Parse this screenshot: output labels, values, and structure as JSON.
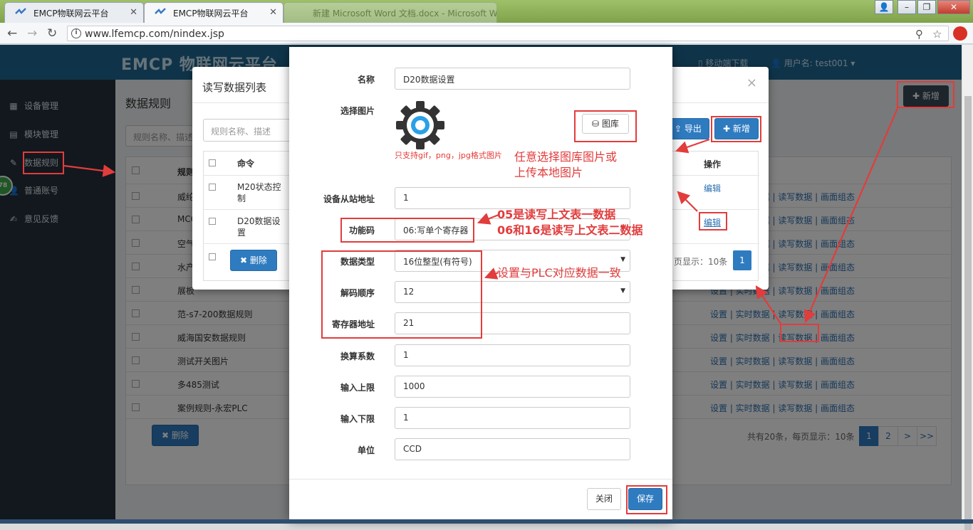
{
  "browser": {
    "tabs": [
      {
        "label": "EMCP物联网云平台"
      },
      {
        "label": "EMCP物联网云平台"
      },
      {
        "label": "新建 Microsoft Word 文档.docx - Microsoft Word"
      }
    ],
    "url": "www.lfemcp.com/nindex.jsp"
  },
  "app": {
    "brand": "EMCP 物联网云平台",
    "header_mobile": "移动端下载",
    "header_user": "用户名: test001"
  },
  "sidebar": {
    "items": [
      {
        "label": "设备管理"
      },
      {
        "label": "模块管理"
      },
      {
        "label": "数据规则"
      },
      {
        "label": "普通账号"
      },
      {
        "label": "意见反馈"
      }
    ],
    "badge": "78"
  },
  "bg": {
    "title": "数据规则",
    "search_placeholder": "规则名称、描述",
    "col_name": "规则",
    "new_label": "新增",
    "delete_label": "删除",
    "rows": [
      {
        "name": "威纶",
        "ops": "设置 | 实时数据 | 读写数据 | 画面组态"
      },
      {
        "name": "MCG",
        "ops": "设置 | 实时数据 | 读写数据 | 画面组态"
      },
      {
        "name": "空气",
        "ops": "设置 | 实时数据 | 读写数据 | 画面组态"
      },
      {
        "name": "水产",
        "ops": "设置 | 实时数据 | 读写数据 | 画面组态"
      },
      {
        "name": "展板",
        "ops": "设置 | 实时数据 | 读写数据 | 画面组态"
      },
      {
        "name": "范-s7-200数据规则",
        "ops": "设置 | 实时数据 | 读写数据 | 画面组态"
      },
      {
        "name": "威海国安数据规则",
        "ops": "设置 | 实时数据 | 读写数据 | 画面组态"
      },
      {
        "name": "测试开关图片",
        "ops": "设置 | 实时数据 | 读写数据 | 画面组态"
      },
      {
        "name": "多485测试",
        "ops": "设置 | 实时数据 | 读写数据 | 画面组态"
      },
      {
        "name": "案例规则-永宏PLC",
        "ops": "设置 | 实时数据 | 读写数据 | 画面组态"
      }
    ],
    "pager_info": "共有20条，每页显示：10条",
    "pages": [
      "1",
      "2",
      ">",
      ">>"
    ]
  },
  "modal_list": {
    "title": "读写数据列表",
    "search_placeholder": "规则名称、描述",
    "export_label": "导出",
    "new_label": "新增",
    "col_cmd": "命令",
    "col_op": "操作",
    "rows": [
      {
        "cmd": "M20状态控制",
        "edit": "编辑"
      },
      {
        "cmd": "D20数据设置",
        "edit": "编辑"
      }
    ],
    "delete_label": "删除",
    "pager_info": "页显示：10条",
    "page": "1"
  },
  "form": {
    "name_label": "名称",
    "name_value": "D20数据设置",
    "image_label": "选择图片",
    "gallery_label": "图库",
    "image_hint": "只支持gif，png，jpg格式图片",
    "slave_label": "设备从站地址",
    "slave_value": "1",
    "func_label": "功能码",
    "func_value": "06:写单个寄存器",
    "dtype_label": "数据类型",
    "dtype_value": "16位整型(有符号)",
    "order_label": "解码顺序",
    "order_value": "12",
    "reg_label": "寄存器地址",
    "reg_value": "21",
    "factor_label": "换算系数",
    "factor_value": "1",
    "max_label": "输入上限",
    "max_value": "1000",
    "min_label": "输入下限",
    "min_value": "1",
    "unit_label": "单位",
    "unit_value": "CCD",
    "close_label": "关闭",
    "save_label": "保存"
  },
  "annotations": {
    "gallery_note_1": "任意选择图库图片或",
    "gallery_note_2": "上传本地图片",
    "func_note_1": "05是读写上文表一数据",
    "func_note_2": "06和16是读写上文表二数据",
    "plc_note": "设置与PLC对应数据一致"
  },
  "colors": {
    "primary": "#2f7bc0",
    "annotation_red": "#e23c3c",
    "header_blue": "#1f6892",
    "sidebar_dark": "#24313d"
  }
}
